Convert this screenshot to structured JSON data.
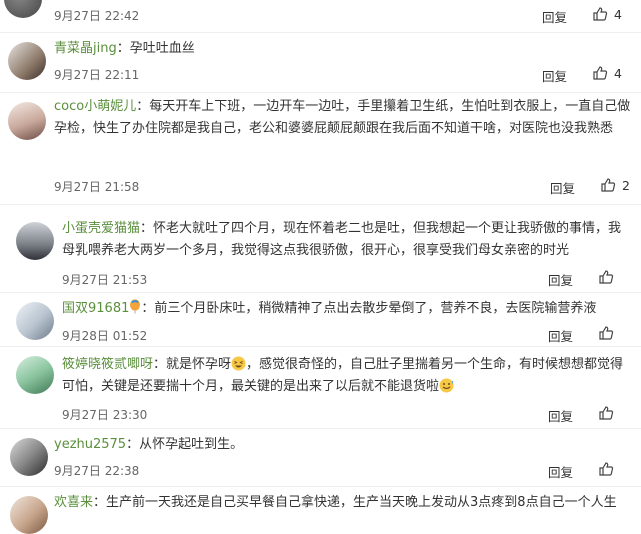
{
  "reply_label": "回复",
  "comments": [
    {
      "user": "",
      "text": "",
      "date": "9月27日 22:42",
      "likes": "4"
    },
    {
      "user": "青菜晶jing",
      "text": "孕吐吐血丝",
      "date": "9月27日 22:11",
      "likes": "4"
    },
    {
      "user": "coco小萌妮儿",
      "text": "每天开车上下班，一边开车一边吐，手里攥着卫生纸，生怕吐到衣服上，一直自己做孕检，快生了办住院都是我自己，老公和婆婆屁颠屁颠跟在我后面不知道干啥，对医院也没我熟悉",
      "date": "9月27日 21:58",
      "likes": "2"
    },
    {
      "user": "小蛋壳爱猫猫",
      "text": "怀老大就吐了四个月，现在怀着老二也是吐，但我想起一个更让我骄傲的事情，我母乳喂养老大两岁一个多月，我觉得这点我很骄傲，很开心，很享受我们母女亲密的时光",
      "date": "9月27日 21:53",
      "likes": ""
    },
    {
      "user": "国双91681",
      "text": "前三个月卧床吐，稍微精神了点出去散步晕倒了，营养不良，去医院输营养液",
      "date": "9月28日 01:52",
      "likes": ""
    },
    {
      "user": "筱婷晓筱贰唧呀",
      "text_a": "就是怀孕呀",
      "text_b": "，感觉很奇怪的，自己肚子里揣着另一个生命，有时候想想都觉得可怕，关键是还要揣十个月，最关键的是出来了以后就不能退货啦",
      "date": "9月27日 23:30",
      "likes": ""
    },
    {
      "user": "yezhu2575",
      "text": "从怀孕起吐到生。",
      "date": "9月27日 22:38",
      "likes": ""
    },
    {
      "user": "欢喜来",
      "text": "生产前一天我还是自己买早餐自己拿快递，生产当天晚上发动从3点疼到8点自己一个人生",
      "date": "",
      "likes": ""
    }
  ],
  "icons": {
    "thumb": "thumbs-up-icon",
    "balloon": "balloon-icon",
    "laugh": "laughing-emoji-icon",
    "grin": "sweat-smile-emoji-icon"
  },
  "colors": {
    "username": "#5a8f3c",
    "meta": "#666666"
  }
}
